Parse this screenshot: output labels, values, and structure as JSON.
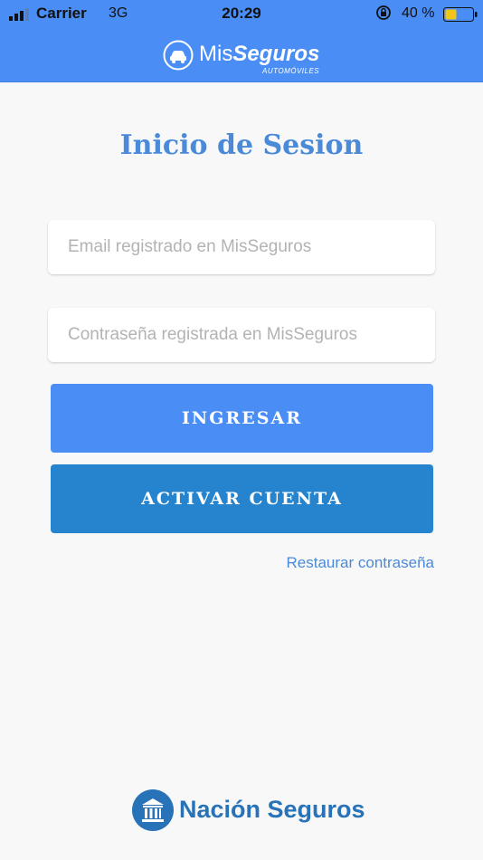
{
  "status_bar": {
    "carrier": "Carrier",
    "network": "3G",
    "time": "20:29",
    "battery_percent": "40 %"
  },
  "header": {
    "logo_mis": "Mis",
    "logo_seguros": "Seguros",
    "logo_subtitle": "AUTOMÓVILES",
    "icon": "car-circle-icon"
  },
  "login": {
    "title": "Inicio de Sesion",
    "email_placeholder": "Email registrado en MisSeguros",
    "email_value": "",
    "password_placeholder": "Contraseña registrada en MisSeguros",
    "password_value": "",
    "login_button": "INGRESAR",
    "activate_button": "ACTIVAR CUENTA",
    "restore_link": "Restaurar contraseña"
  },
  "footer": {
    "brand": "Nación Seguros",
    "icon": "bank-building-icon"
  },
  "colors": {
    "header": "#4a8ef5",
    "title": "#4a8ad8",
    "login_button": "#4a8ef5",
    "activate_button": "#2684cf",
    "footer_brand": "#2872b8",
    "battery_fill": "#f5c518"
  }
}
